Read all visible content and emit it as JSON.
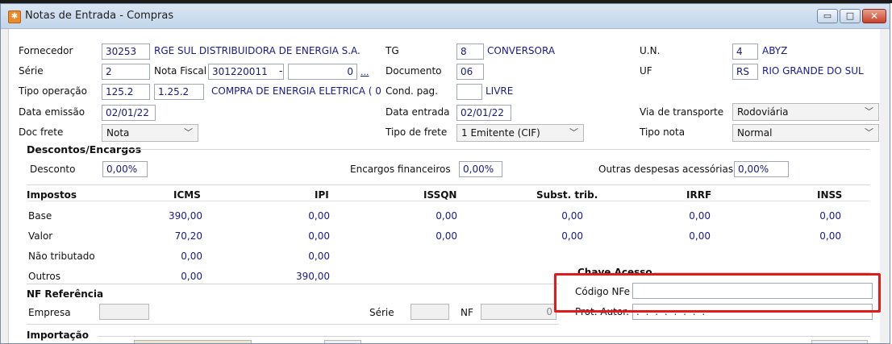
{
  "window": {
    "title": "Notas de Entrada - Compras",
    "minimize": "▭",
    "maximize": "□",
    "close": "✕"
  },
  "fields": {
    "fornecedor": {
      "label": "Fornecedor",
      "code": "30253",
      "name": "RGE SUL DISTRIBUIDORA DE ENERGIA S.A."
    },
    "tg": {
      "label": "TG",
      "code": "8",
      "name": "CONVERSORA"
    },
    "un": {
      "label": "U.N.",
      "code": "4",
      "name": "ABYZ"
    },
    "serie": {
      "label": "Série",
      "value": "2"
    },
    "nota_fiscal": {
      "label": "Nota Fiscal",
      "value": "301220011",
      "dash": "-",
      "digit": "0",
      "ellipsis": "..."
    },
    "documento": {
      "label": "Documento",
      "value": "06"
    },
    "uf": {
      "label": "UF",
      "code": "RS",
      "name": "RIO GRANDE DO SUL"
    },
    "tipo_operacao": {
      "label": "Tipo operação",
      "code1": "125.2",
      "code2": "1.25.2",
      "desc": "COMPRA DE ENERGIA ELETRICA ( 0"
    },
    "cond_pag": {
      "label": "Cond. pag.",
      "code": "",
      "name": "LIVRE"
    },
    "data_emissao": {
      "label": "Data emissão",
      "value": "02/01/22"
    },
    "data_entrada": {
      "label": "Data entrada",
      "value": "02/01/22"
    },
    "via_transporte": {
      "label": "Via de transporte",
      "value": "Rodoviária"
    },
    "doc_frete": {
      "label": "Doc frete",
      "value": "Nota"
    },
    "tipo_frete": {
      "label": "Tipo de frete",
      "value": "1 Emitente (CIF)"
    },
    "tipo_nota": {
      "label": "Tipo nota",
      "value": "Normal"
    }
  },
  "descontos": {
    "title": "Descontos/Encargos",
    "desconto_label": "Desconto",
    "desconto_value": "0,00%",
    "encargos_label": "Encargos financeiros",
    "encargos_value": "0,00%",
    "outras_label": "Outras despesas acessórias",
    "outras_value": "0,00%"
  },
  "impostos": {
    "title": "Impostos",
    "columns": [
      "ICMS",
      "IPI",
      "ISSQN",
      "Subst. trib.",
      "IRRF",
      "INSS"
    ],
    "rows": [
      {
        "label": "Base",
        "values": [
          "390,00",
          "0,00",
          "0,00",
          "0,00",
          "0,00",
          "0,00"
        ]
      },
      {
        "label": "Valor",
        "values": [
          "70,20",
          "0,00",
          "0,00",
          "0,00",
          "0,00",
          "0,00"
        ]
      },
      {
        "label": "Não tributado",
        "values": [
          "0,00",
          "0,00"
        ]
      },
      {
        "label": "Outros",
        "values": [
          "0,00",
          "390,00"
        ]
      }
    ]
  },
  "chave": {
    "title": "Chave Acesso",
    "codigo_label": "Código NFe",
    "codigo_value": "",
    "prot_label": "Prot. Autor.",
    "prot_value": ". . . . . . . ."
  },
  "nf_ref": {
    "title": "NF Referência",
    "empresa_label": "Empresa",
    "serie_label": "Série",
    "nf_label": "NF",
    "nf_value": "0"
  },
  "importacao": {
    "title": "Importação"
  },
  "colors": {
    "highlight": "#e11b1b",
    "value_text": "#1a1a8c"
  }
}
